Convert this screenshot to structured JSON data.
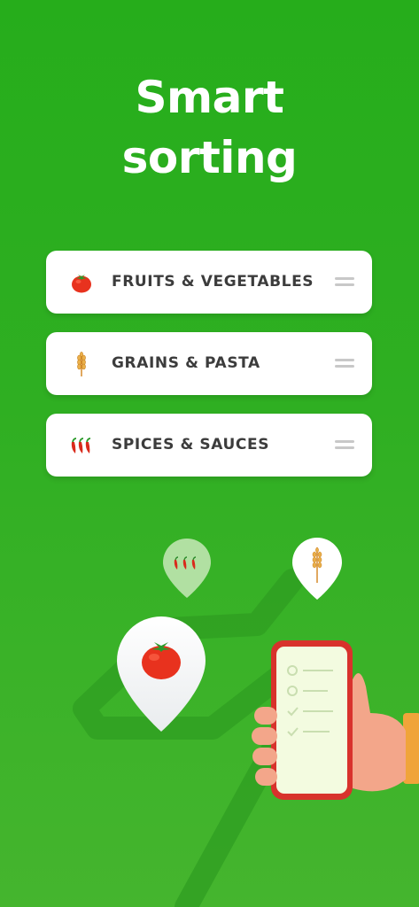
{
  "headline": {
    "line1": "Smart",
    "line2": "sorting"
  },
  "categories": [
    {
      "label": "FRUITS & VEGETABLES",
      "icon": "tomato-icon"
    },
    {
      "label": "GRAINS & PASTA",
      "icon": "wheat-icon"
    },
    {
      "label": "SPICES & SAUCES",
      "icon": "chili-peppers-icon"
    }
  ],
  "colors": {
    "background": "#2aae1e",
    "card": "#ffffff",
    "label": "#3c3c3c",
    "tomato": "#e8321e",
    "wheat": "#e8a23a",
    "phone_frame": "#d8322c",
    "phone_screen": "#f3fbe0"
  },
  "illustration": {
    "description_icons": [
      "map-pin-chili-icon",
      "map-pin-wheat-icon",
      "map-pin-tomato-icon",
      "hand-holding-phone-icon"
    ]
  }
}
